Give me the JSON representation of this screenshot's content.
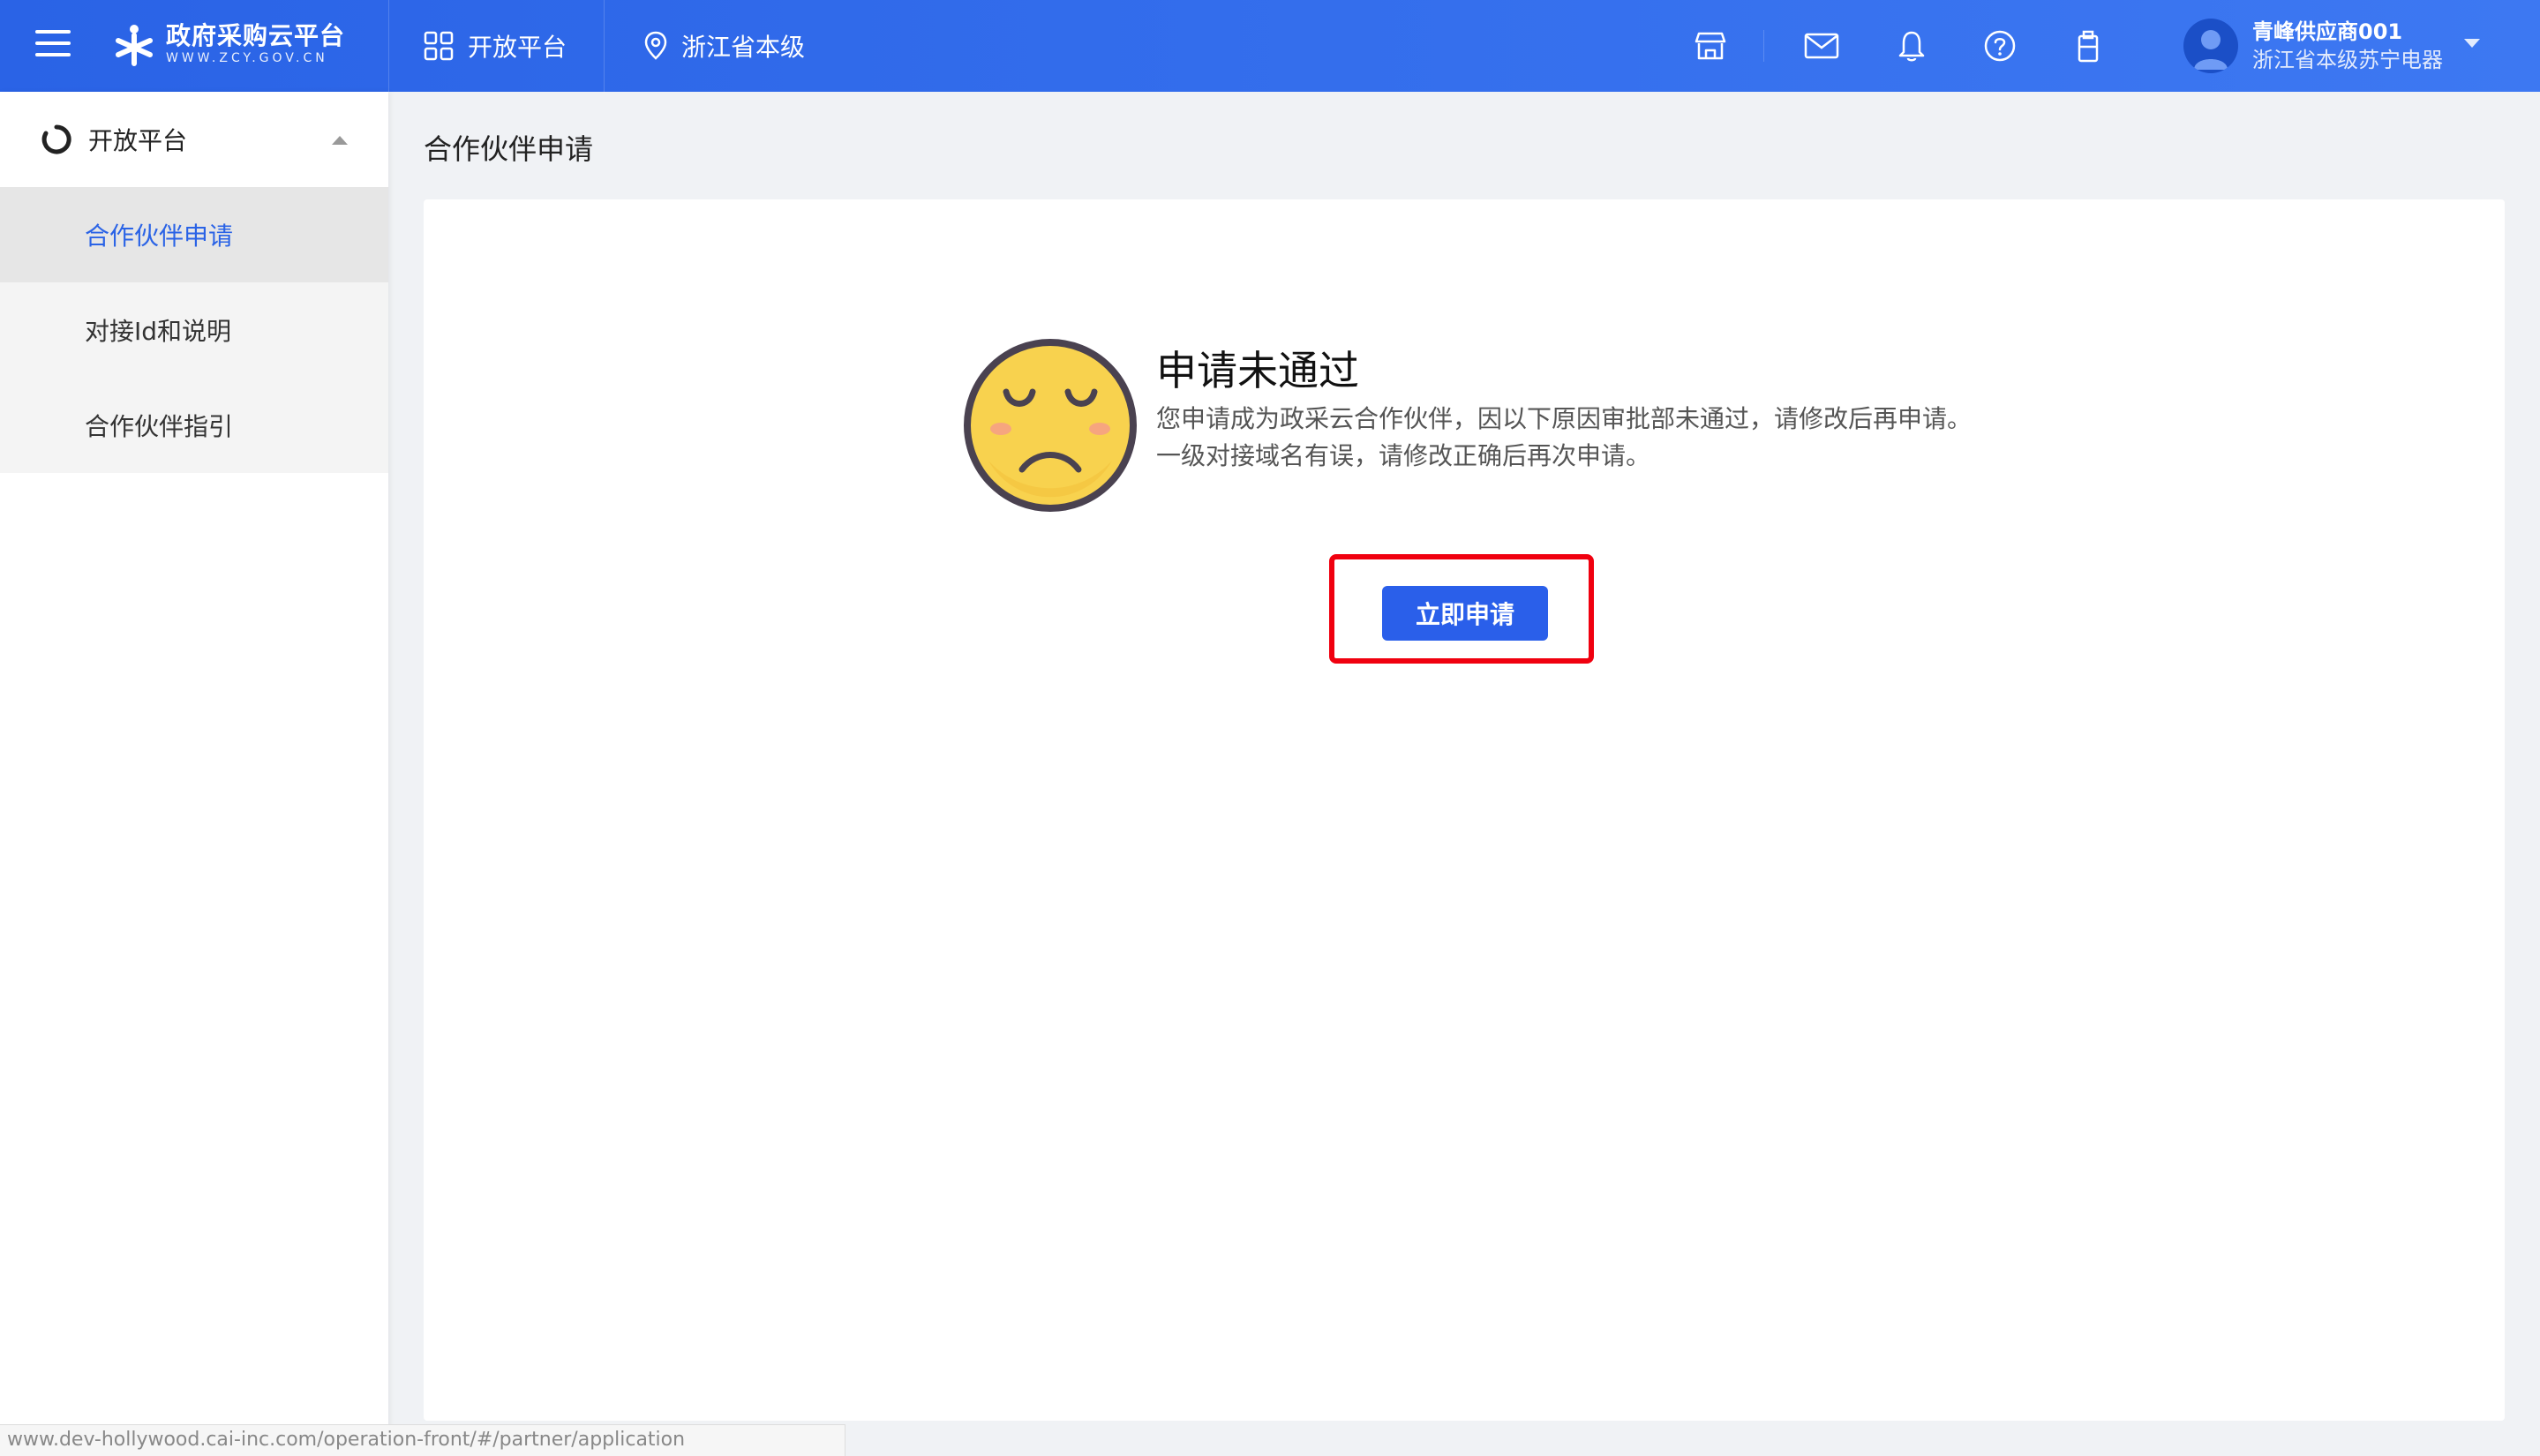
{
  "header": {
    "logo_cn": "政府采购云平台",
    "logo_en": "WWW.ZCY.GOV.CN",
    "nav_platform": "开放平台",
    "nav_region": "浙江省本级",
    "icons": [
      "shop-icon",
      "mail-icon",
      "bell-icon",
      "help-icon",
      "clipboard-icon"
    ],
    "user_name": "青峰供应商001",
    "user_org": "浙江省本级苏宁电器"
  },
  "sidebar": {
    "group_label": "开放平台",
    "items": [
      {
        "label": "合作伙伴申请",
        "active": true
      },
      {
        "label": "对接Id和说明",
        "active": false
      },
      {
        "label": "合作伙伴指引",
        "active": false
      }
    ]
  },
  "main": {
    "page_title": "合作伙伴申请",
    "result_title": "申请未通过",
    "result_desc_1": "您申请成为政采云合作伙伴，因以下原因审批部未通过，请修改后再申请。",
    "result_desc_2": "一级对接域名有误，请修改正确后再次申请。",
    "apply_button": "立即申请"
  },
  "status_url": "www.dev-hollywood.cai-inc.com/operation-front/#/partner/application",
  "colors": {
    "header_blue": "#2a63e6",
    "primary_button": "#2a5fea",
    "highlight_red": "#f0000f",
    "active_item": "#2a63e6"
  }
}
